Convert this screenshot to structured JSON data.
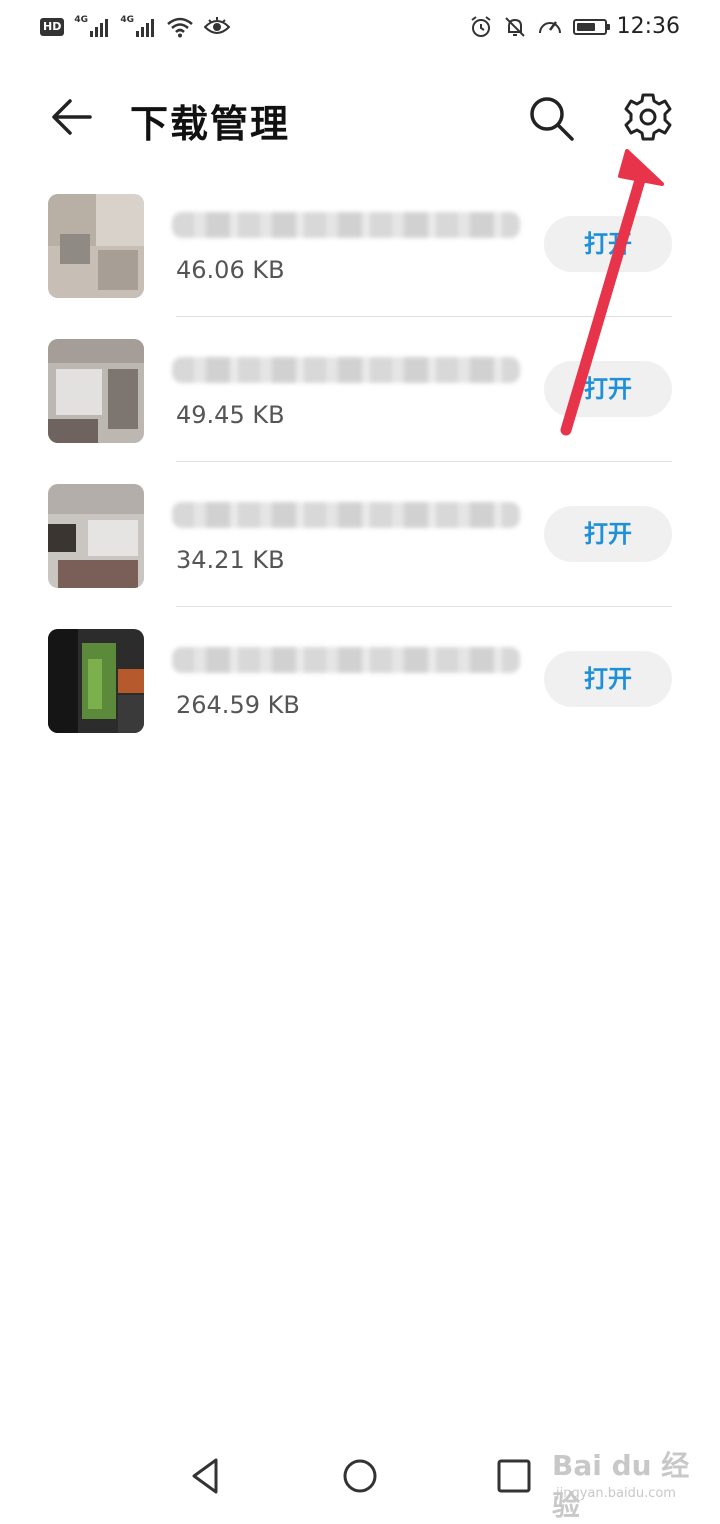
{
  "status_bar": {
    "left": {
      "hd": "HD",
      "sim1_net": "4G",
      "sim2_net": "4G"
    },
    "right": {
      "time": "12:36"
    },
    "icons": [
      "hd-volte-icon",
      "signal-icon",
      "signal-icon",
      "wifi-icon",
      "eye-comfort-icon",
      "alarm-icon",
      "mute-icon",
      "speed-icon",
      "battery-icon"
    ]
  },
  "app_bar": {
    "title": "下载管理",
    "back_icon": "arrow-left-icon",
    "search_icon": "search-icon",
    "settings_icon": "gear-icon"
  },
  "downloads": [
    {
      "size": "46.06 KB",
      "open_label": "打开",
      "thumbnail": "blurred"
    },
    {
      "size": "49.45 KB",
      "open_label": "打开",
      "thumbnail": "blurred"
    },
    {
      "size": "34.21 KB",
      "open_label": "打开",
      "thumbnail": "blurred"
    },
    {
      "size": "264.59 KB",
      "open_label": "打开",
      "thumbnail": "blurred"
    }
  ],
  "annotation": {
    "type": "arrow",
    "color": "#e8344a",
    "points_to": "settings"
  },
  "nav_bar": {
    "icons": [
      "nav-back-icon",
      "nav-home-icon",
      "nav-recent-icon"
    ]
  },
  "watermark": {
    "main": "Bai du 经验",
    "sub": "jingyan.baidu.com"
  },
  "colors": {
    "accent": "#1e90d8",
    "annotation": "#e8344a",
    "button_bg": "#f0f0f0"
  }
}
